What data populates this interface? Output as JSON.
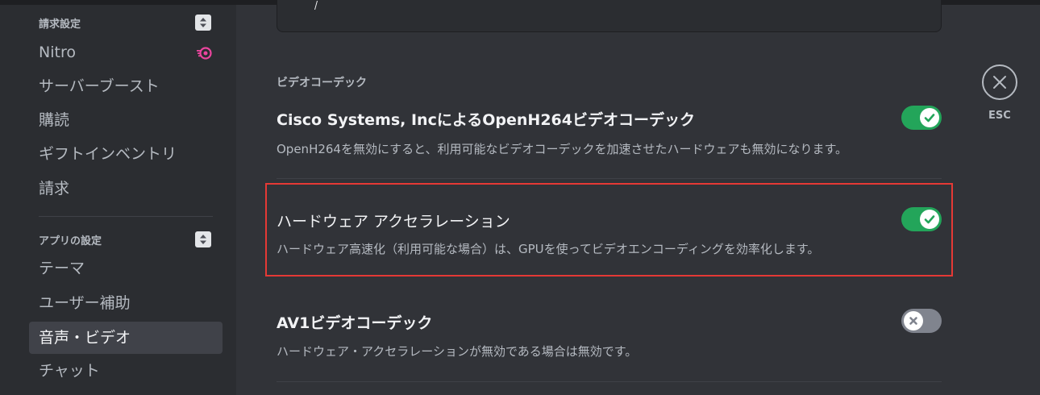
{
  "sidebar": {
    "billing_header": "請求設定",
    "billing_items": [
      {
        "label": "Nitro"
      },
      {
        "label": "サーバーブースト"
      },
      {
        "label": "購読"
      },
      {
        "label": "ギフトインベントリ"
      },
      {
        "label": "請求"
      }
    ],
    "app_header": "アプリの設定",
    "app_items": [
      {
        "label": "テーマ"
      },
      {
        "label": "ユーザー補助"
      },
      {
        "label": "音声・ビデオ",
        "selected": true
      },
      {
        "label": "チャット"
      }
    ]
  },
  "main": {
    "section_title": "ビデオコーデック",
    "rows": [
      {
        "title": "Cisco Systems, IncによるOpenH264ビデオコーデック",
        "desc": "OpenH264を無効にすると、利用可能なビデオコーデックを加速させたハードウェアも無効になります。",
        "enabled": true
      },
      {
        "title": "ハードウェア アクセラレーション",
        "desc": "ハードウェア高速化（利用可能な場合）は、GPUを使ってビデオエンコーディングを効率化します。",
        "enabled": true
      },
      {
        "title": "AV1ビデオコーデック",
        "desc": "ハードウェア・アクセラレーションが無効である場合は無効です。",
        "enabled": false
      }
    ]
  },
  "close": {
    "label": "ESC"
  },
  "colors": {
    "toggle_on": "#23a55a",
    "toggle_off": "#80848e",
    "highlight": "#e53935",
    "nitro": "#eb459e"
  }
}
